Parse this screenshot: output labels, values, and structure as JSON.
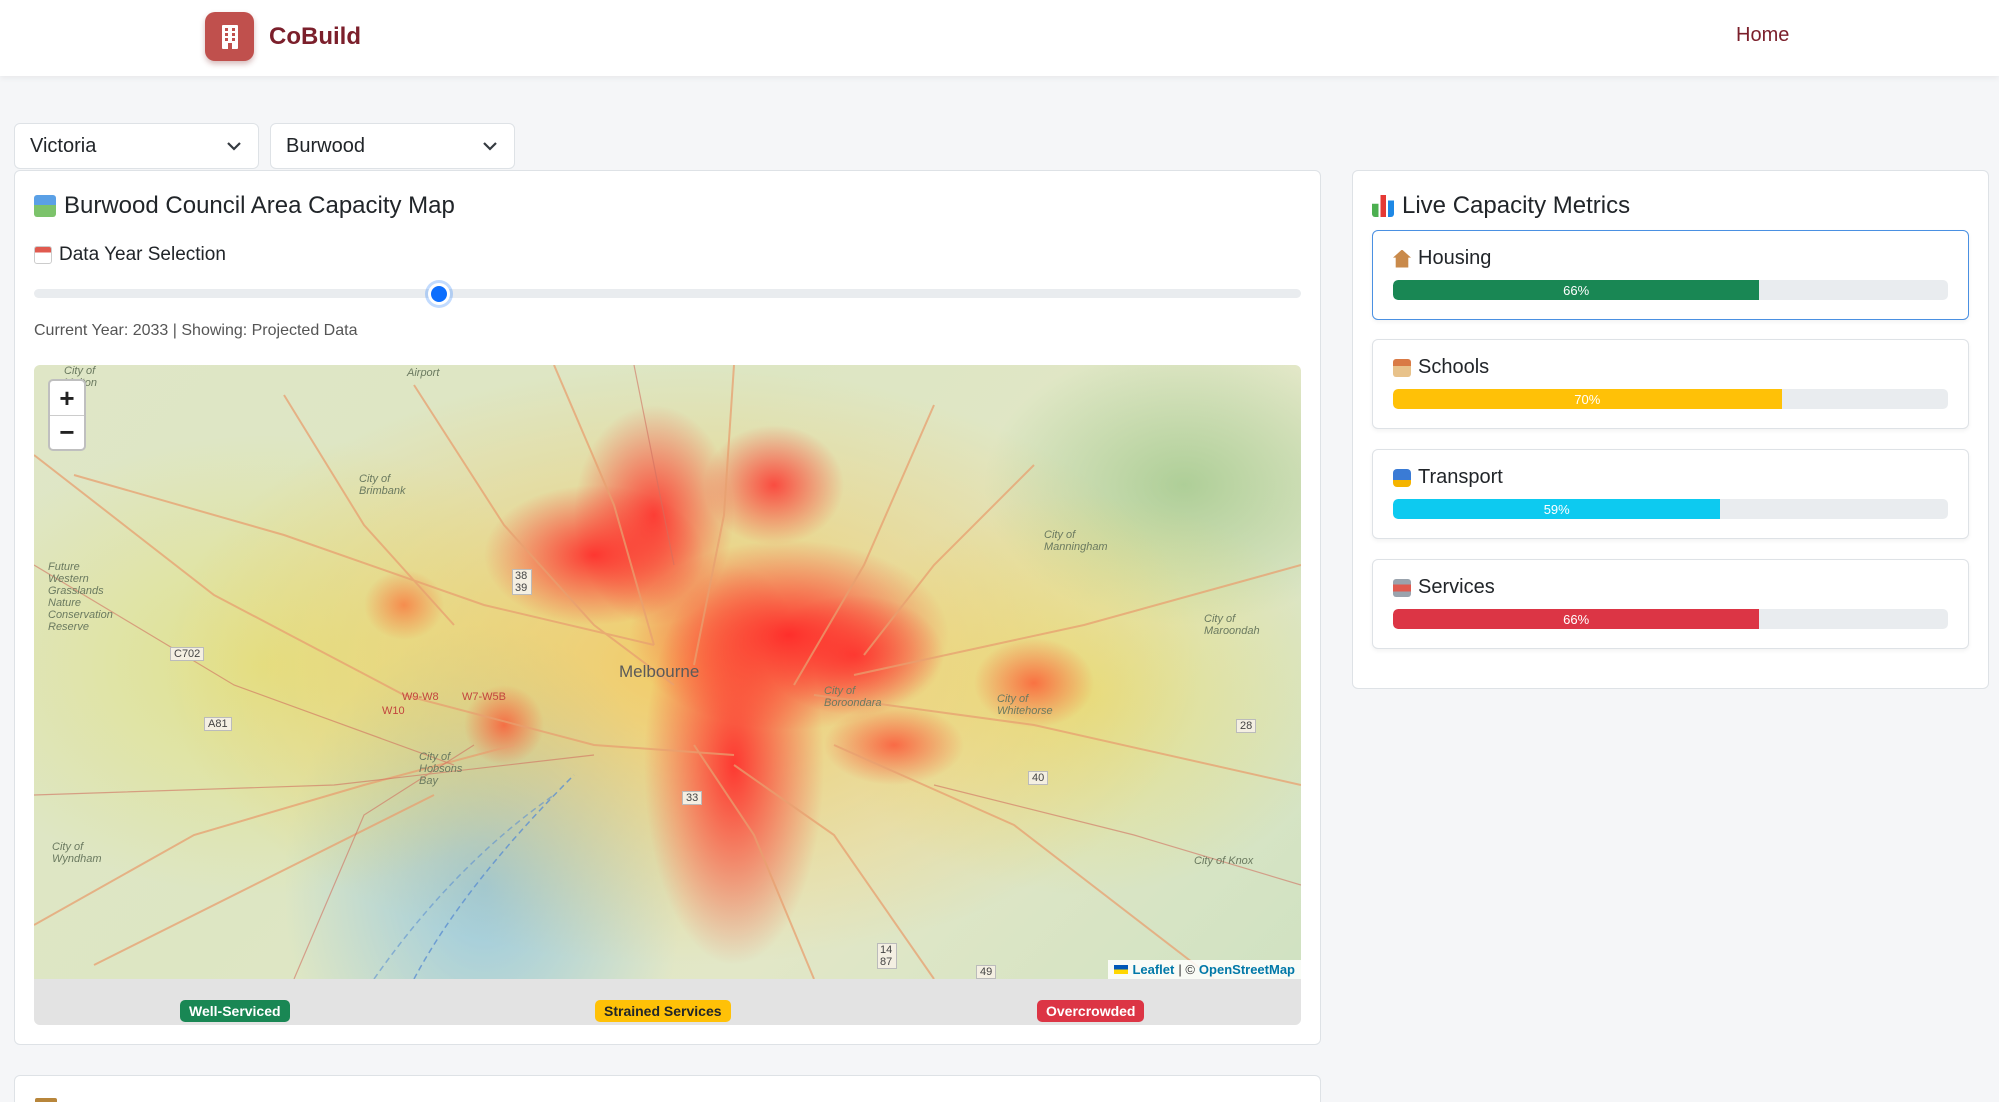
{
  "brand": {
    "name": "CoBuild",
    "icon": "building-icon",
    "color": "#c0504d"
  },
  "nav": {
    "home": "Home"
  },
  "filters": {
    "state": "Victoria",
    "council": "Burwood"
  },
  "map_card": {
    "title": "Burwood Council Area Capacity Map",
    "title_icon": "map-icon",
    "year_label": "Data Year Selection",
    "year_icon": "calendar-icon",
    "slider_value": 0.32,
    "status": "Current Year: 2033 | Showing: Projected Data"
  },
  "map": {
    "city": "Melbourne",
    "place_labels": [
      "Airport",
      "City of Brimbank",
      "Future Western Grasslands Nature Conservation Reserve",
      "City of Hobsons Bay",
      "City of Wyndham",
      "City of Manningham",
      "City of Whitehorse",
      "City of Maroondah",
      "City of Knox",
      "City of Boroondara",
      "City of Melton"
    ],
    "road_labels": [
      "C702",
      "A81",
      "W10",
      "W9-W8",
      "W7-W5B",
      "33",
      "40",
      "28",
      "14 87",
      "49",
      "38 39"
    ],
    "zoom_in": "+",
    "zoom_out": "−",
    "attribution_leaflet": "Leaflet",
    "attribution_sep": "| ©",
    "attribution_osm": "OpenStreetMap"
  },
  "legend": {
    "well": "Well-Serviced",
    "strained": "Strained Services",
    "overcrowded": "Overcrowded",
    "colors": {
      "well": "#198754",
      "strained": "#ffc107",
      "overcrowded": "#dc3545"
    }
  },
  "metrics_card": {
    "title": "Live Capacity Metrics",
    "title_icon": "bar-chart-icon",
    "items": [
      {
        "label": "Housing",
        "icon": "house-icon",
        "value": 66,
        "text": "66%",
        "color": "#198754"
      },
      {
        "label": "Schools",
        "icon": "school-icon",
        "value": 70,
        "text": "70%",
        "color": "#ffc107"
      },
      {
        "label": "Transport",
        "icon": "bus-icon",
        "value": 59,
        "text": "59%",
        "color": "#0dcaf0"
      },
      {
        "label": "Services",
        "icon": "hospital-icon",
        "value": 66,
        "text": "66%",
        "color": "#dc3545"
      }
    ]
  }
}
